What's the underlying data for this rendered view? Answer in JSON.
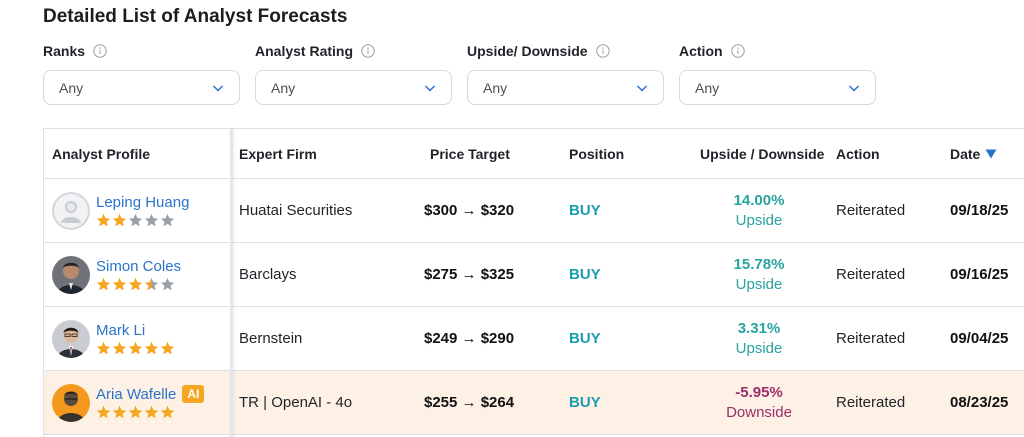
{
  "page_title": "Detailed List of Analyst Forecasts",
  "filters": [
    {
      "label": "Ranks",
      "value": "Any"
    },
    {
      "label": "Analyst Rating",
      "value": "Any"
    },
    {
      "label": "Upside/ Downside",
      "value": "Any"
    },
    {
      "label": "Action",
      "value": "Any"
    }
  ],
  "table": {
    "headers": {
      "profile": "Analyst Profile",
      "firm": "Expert Firm",
      "price": "Price Target",
      "position": "Position",
      "updown": "Upside / Downside",
      "action": "Action",
      "date": "Date"
    },
    "rows": [
      {
        "name": "Leping Huang",
        "rating": 2,
        "firm": "Huatai Securities",
        "price": "$300 → $320",
        "position": "BUY",
        "updown_value": "14.00%",
        "updown_word": "Upside",
        "action": "Reiterated",
        "date": "09/18/25"
      },
      {
        "name": "Simon Coles",
        "rating": 3.5,
        "firm": "Barclays",
        "price": "$275 → $325",
        "position": "BUY",
        "updown_value": "15.78%",
        "updown_word": "Upside",
        "action": "Reiterated",
        "date": "09/16/25"
      },
      {
        "name": "Mark Li",
        "rating": 5,
        "firm": "Bernstein",
        "price": "$249 → $290",
        "position": "BUY",
        "updown_value": "3.31%",
        "updown_word": "Upside",
        "action": "Reiterated",
        "date": "09/04/25"
      },
      {
        "name": "Aria Wafelle",
        "badge": "AI",
        "rating": 5,
        "firm": "TR | OpenAI - 4o",
        "price": "$255 → $264",
        "position": "BUY",
        "updown_value": "-5.95%",
        "updown_word": "Downside",
        "action": "Reiterated",
        "date": "08/23/25"
      }
    ]
  },
  "colors": {
    "link": "#2a73c9",
    "buy": "#1f9bb0",
    "upside": "#27a3a0",
    "downside": "#9b2d6a",
    "star_filled": "#f5a623",
    "star_empty": "#9ba1a8",
    "ai_badge": "#f5a623",
    "highlight_row": "#fdf1e6"
  },
  "icons": [
    "info-icon",
    "chevron-down-icon",
    "sort-descending-icon",
    "star-icon"
  ]
}
